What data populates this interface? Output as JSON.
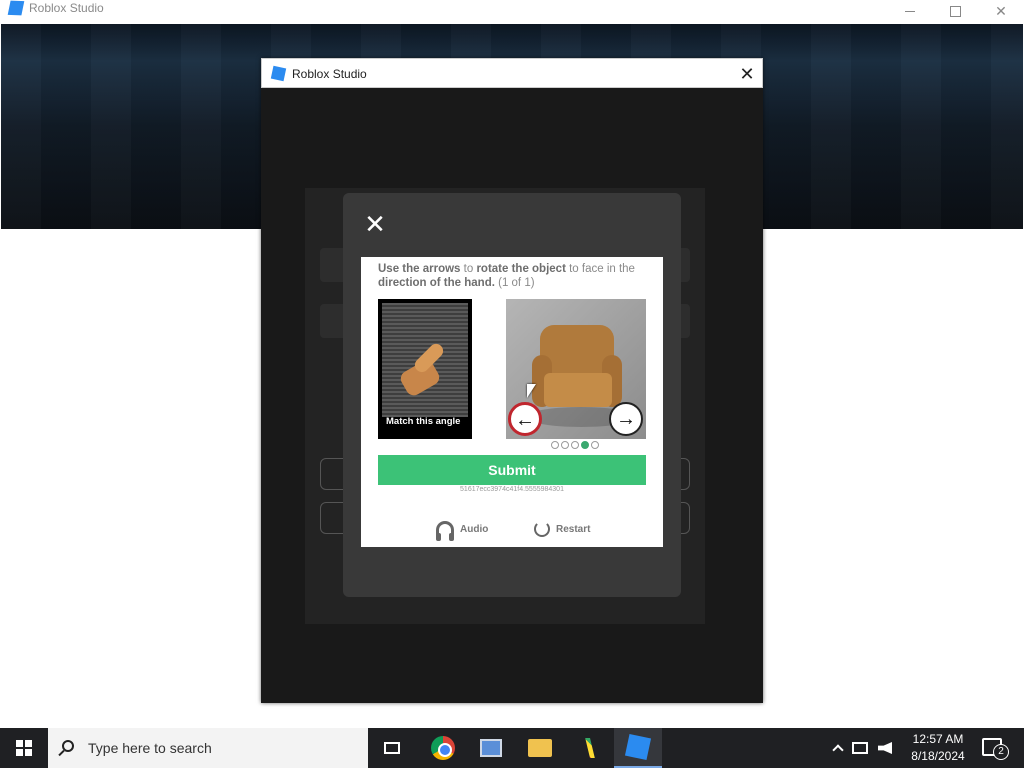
{
  "outer_window": {
    "title": "Roblox Studio",
    "controls": {
      "minimize": "—",
      "maximize": "□",
      "close": "✕"
    }
  },
  "dialog": {
    "title": "Roblox Studio",
    "close_label": "✕"
  },
  "captcha": {
    "close_label": "✕",
    "instruction_parts": {
      "p1": "Use the arrows",
      "p2": " to ",
      "p3": "rotate the object",
      "p4": " to face in the ",
      "p5": "direction of the hand.",
      "p6": " (1 of 1)"
    },
    "reference_label": "Match this angle",
    "left_arrow": "←",
    "right_arrow": "→",
    "pager": {
      "total": 5,
      "active_index": 3
    },
    "submit_label": "Submit",
    "session_id": "51617ecc3974c41f4.5555984301",
    "audio_label": "Audio",
    "restart_label": "Restart"
  },
  "taskbar": {
    "search_placeholder": "Type here to search",
    "time": "12:57 AM",
    "date": "8/18/2024",
    "notification_count": "2"
  },
  "icons": [
    "roblox-logo-icon",
    "close-icon",
    "hand-icon",
    "chair-image",
    "arrow-left-icon",
    "arrow-right-icon",
    "headphones-icon",
    "restart-icon",
    "windows-start-icon",
    "search-icon",
    "task-view-icon",
    "chrome-icon",
    "pc-icon",
    "folder-icon",
    "code-icon",
    "roblox-studio-icon",
    "chevron-up-icon",
    "network-icon",
    "volume-muted-icon",
    "notification-icon"
  ],
  "colors": {
    "submit_green": "#3cc277",
    "pager_active": "#39a86e",
    "left_arrow_ring": "#c0262e",
    "roblox_blue": "#2b8bf0"
  }
}
